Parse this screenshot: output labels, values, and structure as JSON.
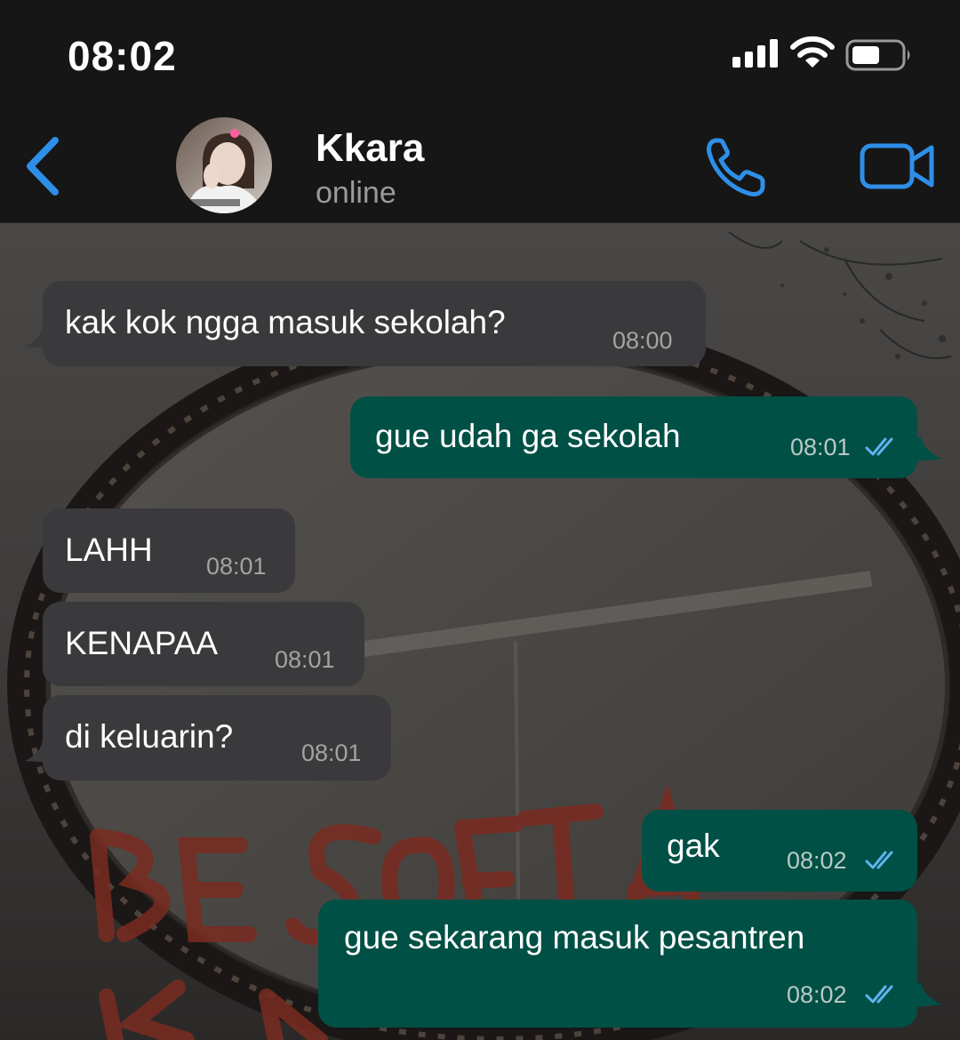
{
  "status_bar": {
    "time": "08:02"
  },
  "header": {
    "contact_name": "Kkara",
    "contact_status": "online"
  },
  "messages": [
    {
      "direction": "incoming",
      "text": "kak kok ngga masuk sekolah?",
      "time": "08:00"
    },
    {
      "direction": "outgoing",
      "text": "gue udah ga sekolah",
      "time": "08:01",
      "read": true
    },
    {
      "direction": "incoming",
      "text": "LAHH",
      "time": "08:01"
    },
    {
      "direction": "incoming",
      "text": "KENAPAA",
      "time": "08:01"
    },
    {
      "direction": "incoming",
      "text": "di keluarin?",
      "time": "08:01"
    },
    {
      "direction": "outgoing",
      "text": "gak",
      "time": "08:02",
      "read": true
    },
    {
      "direction": "outgoing",
      "text": "gue sekarang masuk pesantren",
      "time": "08:02",
      "read": true
    }
  ],
  "colors": {
    "accent": "#2e8fe8",
    "incoming_bubble": "#3a3a3c",
    "outgoing_bubble": "#005045",
    "read_ticks": "#5fb3f0"
  },
  "icons": [
    "back-icon",
    "call-icon",
    "video-call-icon",
    "signal-icon",
    "wifi-icon",
    "battery-icon",
    "read-receipt-icon"
  ]
}
